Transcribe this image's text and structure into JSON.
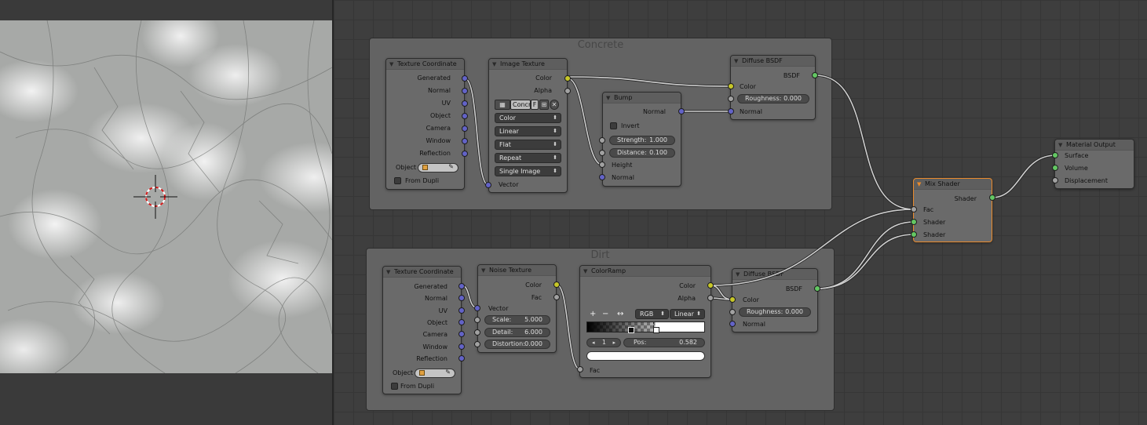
{
  "colors": {
    "selected_outline": "#e98a2c",
    "vector_socket": "#6363c7",
    "color_socket": "#c7c729",
    "float_socket": "#a1a1a1",
    "shader_socket": "#63c763"
  },
  "frames": {
    "concrete_title": "Concrete",
    "dirt_title": "Dirt"
  },
  "concrete": {
    "texcoord": {
      "title": "Texture Coordinate",
      "outputs": [
        "Generated",
        "Normal",
        "UV",
        "Object",
        "Camera",
        "Window",
        "Reflection"
      ],
      "object_label": "Object",
      "from_dupli": "From Dupli"
    },
    "image": {
      "title": "Image Texture",
      "out_color": "Color",
      "out_alpha": "Alpha",
      "image_name": "Concr",
      "fake_user": "F",
      "color_space": "Color",
      "interpolation": "Linear",
      "projection": "Flat",
      "extension": "Repeat",
      "source": "Single Image",
      "in_vector": "Vector"
    },
    "bump": {
      "title": "Bump",
      "out_normal": "Normal",
      "invert": "Invert",
      "strength_label": "Strength:",
      "strength_value": "1.000",
      "distance_label": "Distance:",
      "distance_value": "0.100",
      "in_height": "Height",
      "in_normal": "Normal"
    },
    "diffuse": {
      "title": "Diffuse BSDF",
      "out_bsdf": "BSDF",
      "in_color": "Color",
      "roughness_label": "Roughness:",
      "roughness_value": "0.000",
      "in_normal": "Normal"
    }
  },
  "dirt": {
    "texcoord": {
      "title": "Texture Coordinate",
      "outputs": [
        "Generated",
        "Normal",
        "UV",
        "Object",
        "Camera",
        "Window",
        "Reflection"
      ],
      "object_label": "Object",
      "from_dupli": "From Dupli"
    },
    "noise": {
      "title": "Noise Texture",
      "out_color": "Color",
      "out_fac": "Fac",
      "in_vector": "Vector",
      "scale_label": "Scale:",
      "scale_value": "5.000",
      "detail_label": "Detail:",
      "detail_value": "6.000",
      "distortion_label": "Distortion:",
      "distortion_value": "0.000"
    },
    "ramp": {
      "title": "ColorRamp",
      "out_color": "Color",
      "out_alpha": "Alpha",
      "add": "+",
      "remove": "−",
      "flip": "↔",
      "color_mode": "RGB",
      "interpolation": "Linear",
      "active_index": "1",
      "pos_label": "Pos:",
      "pos_value": "0.582",
      "in_fac": "Fac"
    },
    "diffuse": {
      "title": "Diffuse BSDF",
      "out_bsdf": "BSDF",
      "in_color": "Color",
      "roughness_label": "Roughness:",
      "roughness_value": "0.000",
      "in_normal": "Normal"
    }
  },
  "mix": {
    "title": "Mix Shader",
    "out_shader": "Shader",
    "in_fac": "Fac",
    "in_shader1": "Shader",
    "in_shader2": "Shader"
  },
  "output": {
    "title": "Material Output",
    "in_surface": "Surface",
    "in_volume": "Volume",
    "in_displacement": "Displacement"
  }
}
